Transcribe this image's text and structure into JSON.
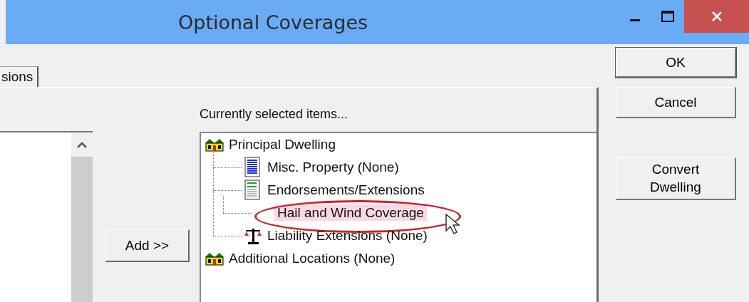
{
  "window": {
    "title": "Optional Coverages"
  },
  "tabs": [
    {
      "label": "sions"
    }
  ],
  "add_button": {
    "label": "Add >>"
  },
  "selected_items": {
    "label": "Currently selected items...",
    "tree": [
      {
        "label": "Principal Dwelling",
        "kind": "house",
        "selected": false,
        "expanded": true,
        "children": [
          {
            "label": "Misc. Property (None)",
            "kind": "list",
            "selected": false
          },
          {
            "label": "Endorsements/Extensions",
            "kind": "form",
            "selected": false,
            "expanded": true,
            "children": [
              {
                "label": "Hail and Wind Coverage",
                "selected": true
              }
            ]
          },
          {
            "label": "Liability Extensions (None)",
            "kind": "scales",
            "selected": false
          }
        ]
      },
      {
        "label": "Additional Locations (None)",
        "kind": "house",
        "selected": false
      }
    ]
  },
  "buttons": [
    {
      "label": "OK",
      "default": true
    },
    {
      "label": "Cancel",
      "default": false
    },
    {
      "label": "Convert Dwelling",
      "default": false
    }
  ]
}
